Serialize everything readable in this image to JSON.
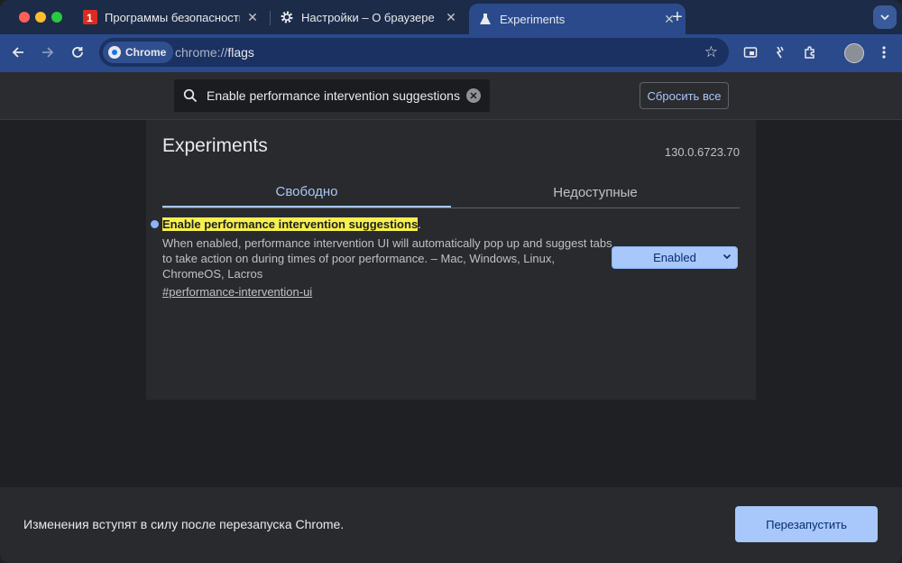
{
  "browser": {
    "tabs": [
      {
        "title": "Программы безопасности.ru",
        "favicon": "red-app-icon"
      },
      {
        "title": "Настройки – О браузере Chrome",
        "favicon": "gear-icon"
      },
      {
        "title": "Experiments",
        "favicon": "flask-icon",
        "active": true
      }
    ],
    "new_tab": "+",
    "chip_label": "Chrome",
    "url_scheme": "chrome://",
    "url_path": "flags"
  },
  "flags": {
    "search_value": "Enable performance intervention suggestions",
    "reset_label": "Сбросить все",
    "title": "Experiments",
    "version": "130.0.6723.70",
    "tabs": [
      "Свободно",
      "Недоступные"
    ],
    "experiment": {
      "name": "Enable performance intervention suggestions",
      "description": "When enabled, performance intervention UI will automatically pop up and suggest tabs to take action on during times of poor performance. – Mac, Windows, Linux, ChromeOS, Lacros",
      "link": "#performance-intervention-ui",
      "state": "Enabled"
    }
  },
  "relaunch": {
    "message": "Изменения вступят в силу после перезапуска Chrome.",
    "button": "Перезапустить"
  },
  "colors": {
    "accent": "#a8c7fa",
    "highlight": "#f7f04d",
    "toolbar": "#2a4a8b"
  }
}
